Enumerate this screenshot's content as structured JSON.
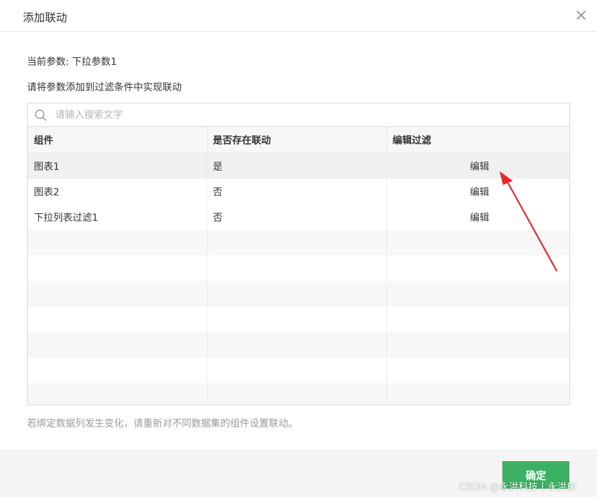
{
  "dialog": {
    "title": "添加联动",
    "param_line": "当前参数: 下拉参数1",
    "instruction": "请将参数添加到过滤条件中实现联动",
    "footnote": "若绑定数据列发生变化，请重新对不同数据集的组件设置联动。",
    "ok_label": "确定"
  },
  "search": {
    "placeholder": "请输入搜索文字",
    "value": ""
  },
  "table": {
    "columns": [
      "组件",
      "是否存在联动",
      "编辑过滤"
    ],
    "rows": [
      {
        "component": "图表1",
        "linked": "是",
        "action": "编辑"
      },
      {
        "component": "图表2",
        "linked": "否",
        "action": "编辑"
      },
      {
        "component": "下拉列表过滤1",
        "linked": "否",
        "action": "编辑"
      }
    ]
  },
  "watermark": "CSDN @永洪科技丨永洪BI",
  "colors": {
    "primary_button": "#3cb063",
    "annotation_arrow": "#e8252a"
  },
  "icons": {
    "close": "close-icon",
    "search": "search-icon"
  }
}
